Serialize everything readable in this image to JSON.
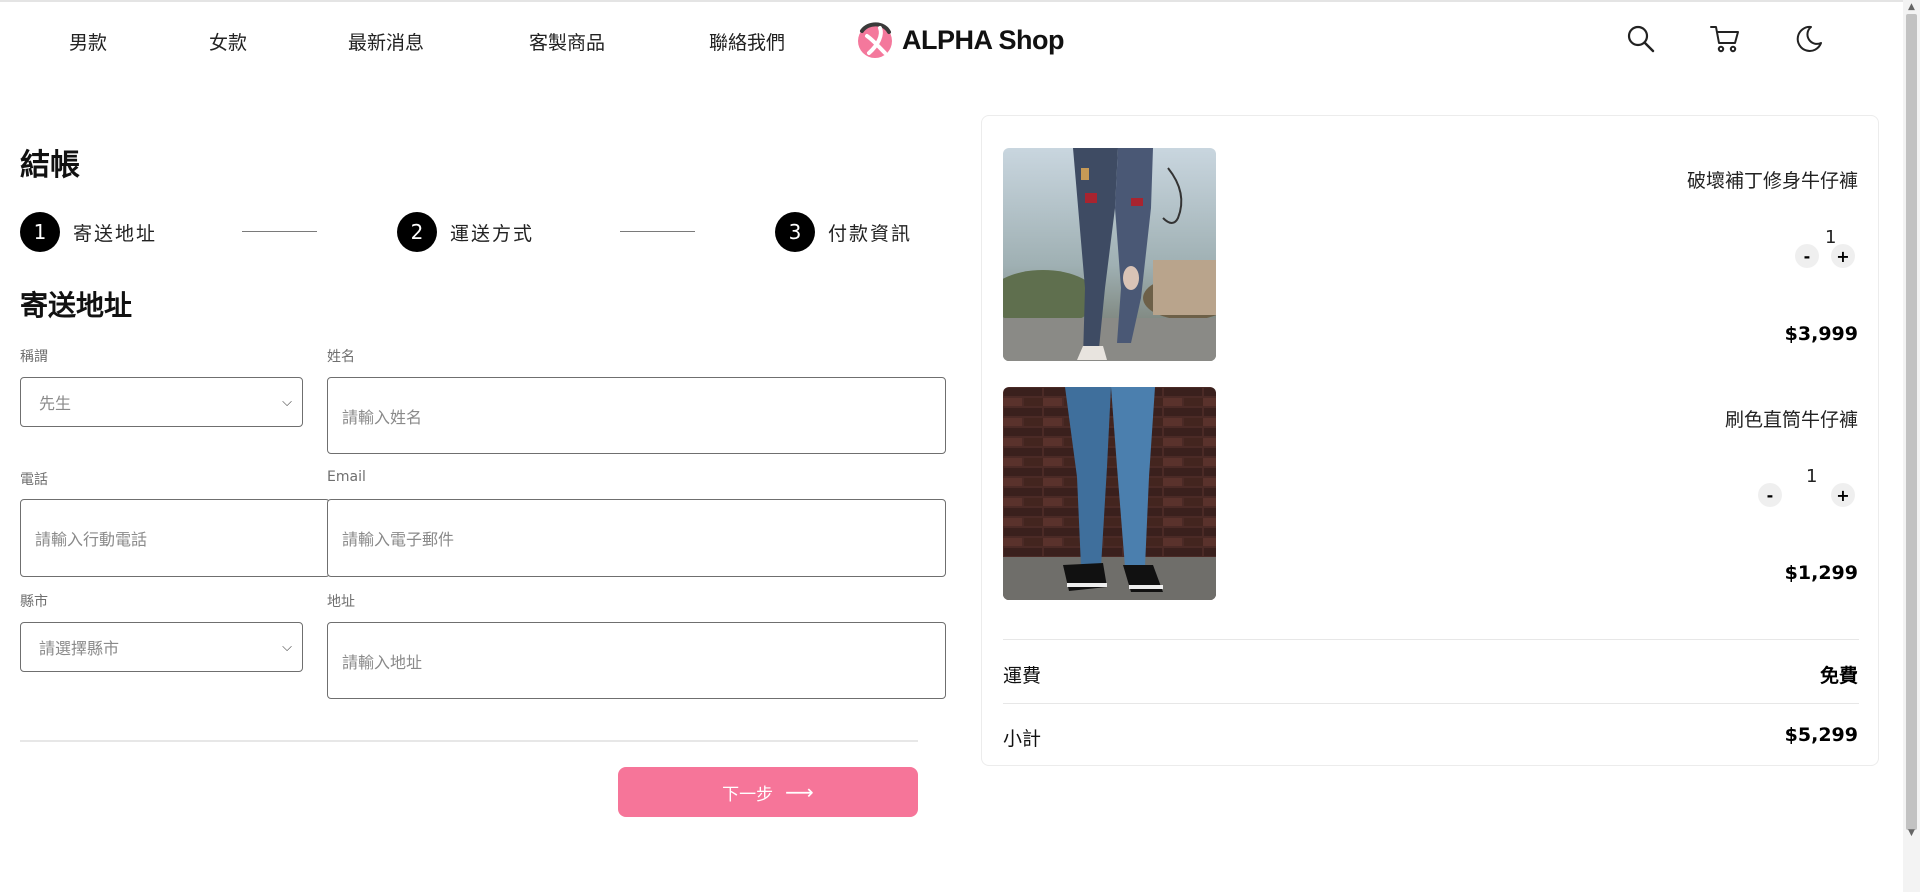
{
  "nav": {
    "items": [
      {
        "label": "男款"
      },
      {
        "label": "女款"
      },
      {
        "label": "最新消息"
      },
      {
        "label": "客製商品"
      },
      {
        "label": "聯絡我們"
      }
    ],
    "logo_text": "ALPHA Shop",
    "icons": [
      "search-icon",
      "cart-icon",
      "moon-icon"
    ]
  },
  "checkout": {
    "title": "結帳",
    "steps": [
      {
        "number": "1",
        "label": "寄送地址"
      },
      {
        "number": "2",
        "label": "運送方式"
      },
      {
        "number": "3",
        "label": "付款資訊"
      }
    ],
    "section_title": "寄送地址",
    "form": {
      "salutation": {
        "label": "稱謂",
        "value": "先生"
      },
      "name": {
        "label": "姓名",
        "placeholder": "請輸入姓名"
      },
      "phone": {
        "label": "電話",
        "placeholder": "請輸入行動電話"
      },
      "email": {
        "label": "Email",
        "placeholder": "請輸入電子郵件"
      },
      "city": {
        "label": "縣市",
        "value": "請選擇縣市"
      },
      "address": {
        "label": "地址",
        "placeholder": "請輸入地址"
      }
    },
    "next_button": {
      "label": "下一步",
      "icon": "arrow-right-icon"
    }
  },
  "cart": {
    "items": [
      {
        "name": "破壞補丁修身牛仔褲",
        "quantity": "1",
        "price": "$3,999",
        "minus": "-",
        "plus": "+"
      },
      {
        "name": "刷色直筒牛仔褲",
        "quantity": "1",
        "price": "$1,299",
        "minus": "-",
        "plus": "+"
      }
    ],
    "shipping": {
      "label": "運費",
      "value": "免費"
    },
    "subtotal": {
      "label": "小計",
      "value": "$5,299"
    }
  },
  "colors": {
    "accent": "#f67599",
    "logo_pink": "#f06b95",
    "text": "#2a2a2a",
    "step_circle": "#000000"
  }
}
